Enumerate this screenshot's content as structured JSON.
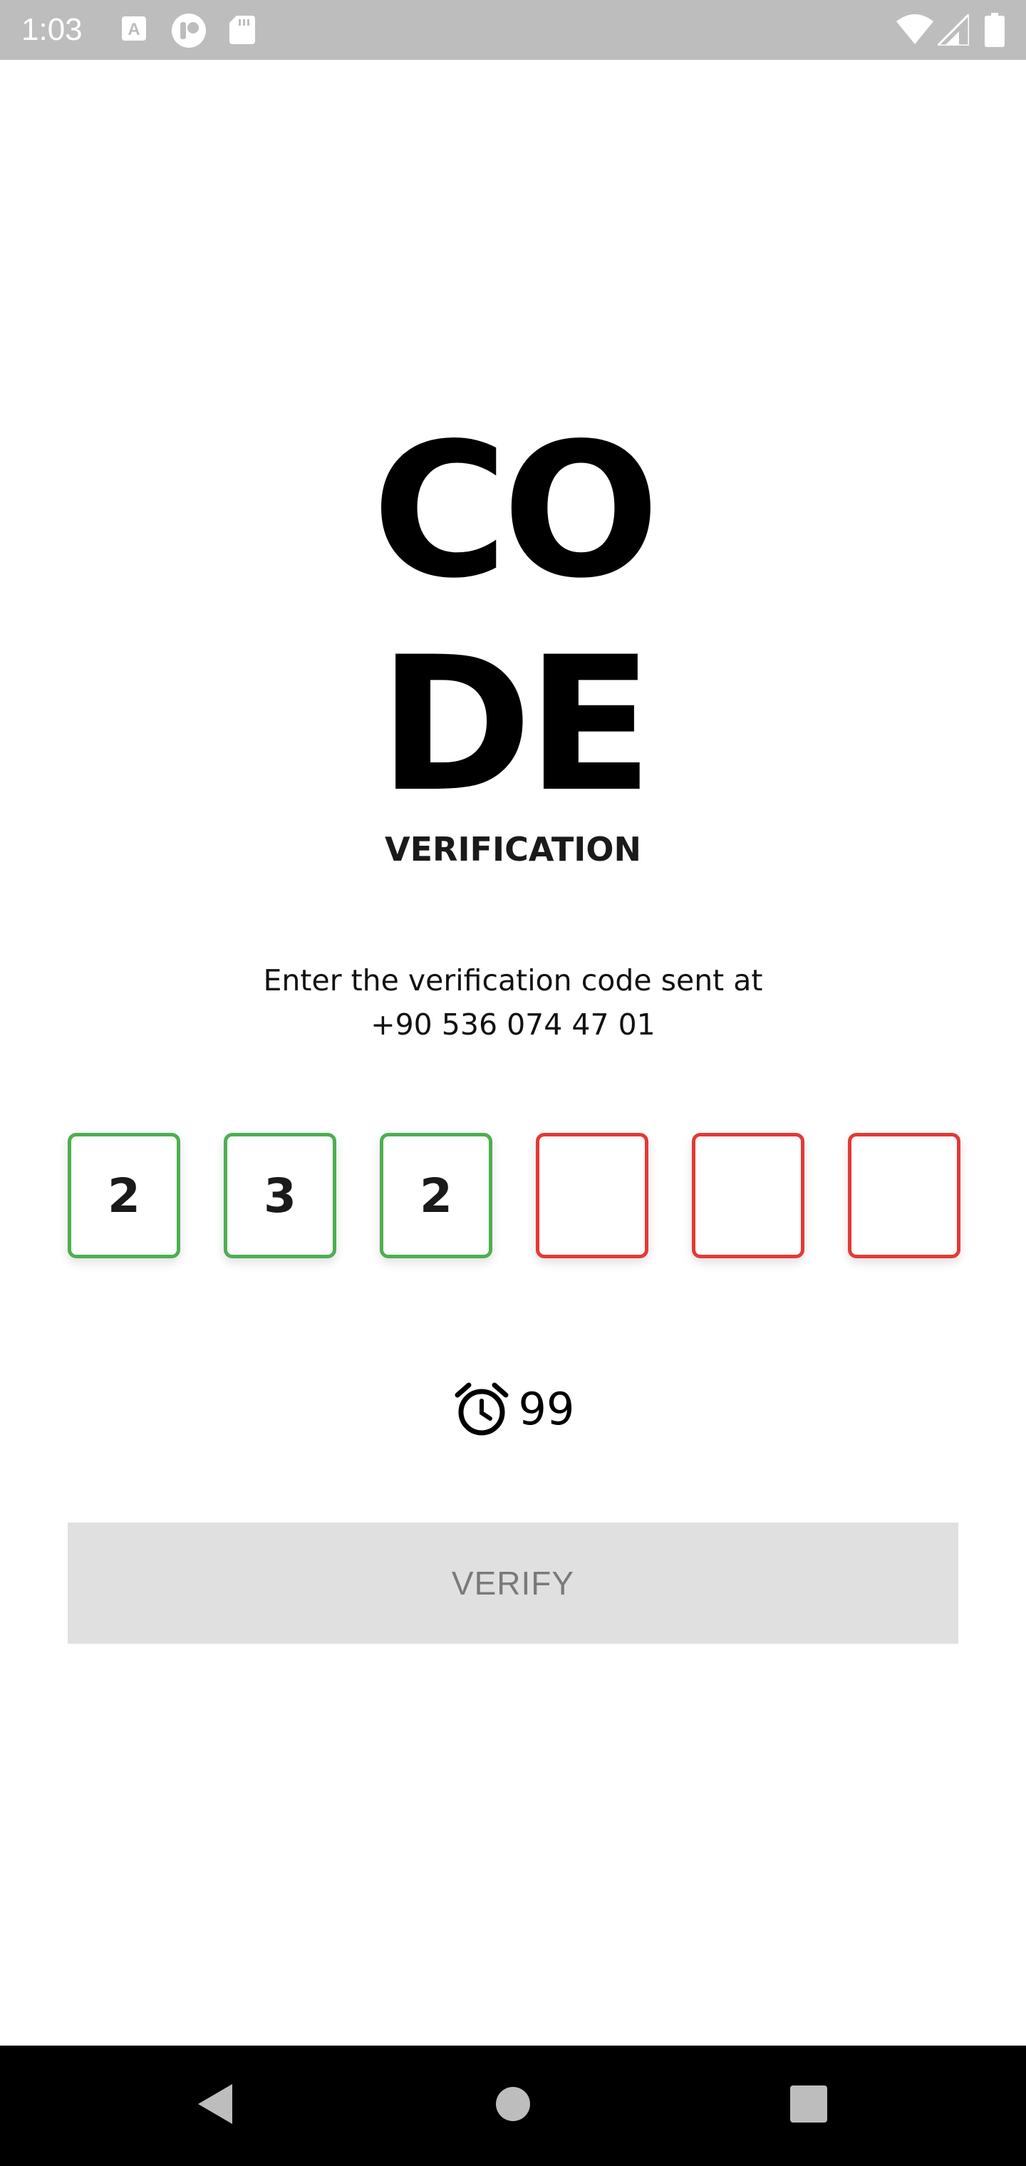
{
  "status_bar": {
    "time": "1:03",
    "background_color": "#bdbdbd",
    "left_icons": [
      "font-a-icon",
      "app-status-icon",
      "sd-card-icon"
    ],
    "right_icons": [
      "wifi-icon",
      "cell-signal-icon",
      "battery-icon"
    ]
  },
  "header": {
    "title_line_1": "CO",
    "title_line_2": "DE",
    "subtitle": "VERIFICATION"
  },
  "instruction": {
    "line_1": "Enter the verification code sent at",
    "phone_number": "+90 536 074 47 01"
  },
  "code_inputs": [
    {
      "value": "2",
      "state": "filled"
    },
    {
      "value": "3",
      "state": "filled"
    },
    {
      "value": "2",
      "state": "filled"
    },
    {
      "value": "",
      "state": "empty"
    },
    {
      "value": "",
      "state": "empty"
    },
    {
      "value": "",
      "state": "empty"
    }
  ],
  "colors": {
    "filled_border": "#4caf50",
    "empty_border": "#e53935",
    "button_background": "#e0e0e0",
    "button_text": "#7a7a7a"
  },
  "timer": {
    "icon": "alarm-clock-icon",
    "value": "99"
  },
  "verify_button": {
    "label": "VERIFY"
  },
  "nav_bar": {
    "buttons": [
      "back-icon",
      "home-icon",
      "recents-icon"
    ]
  }
}
